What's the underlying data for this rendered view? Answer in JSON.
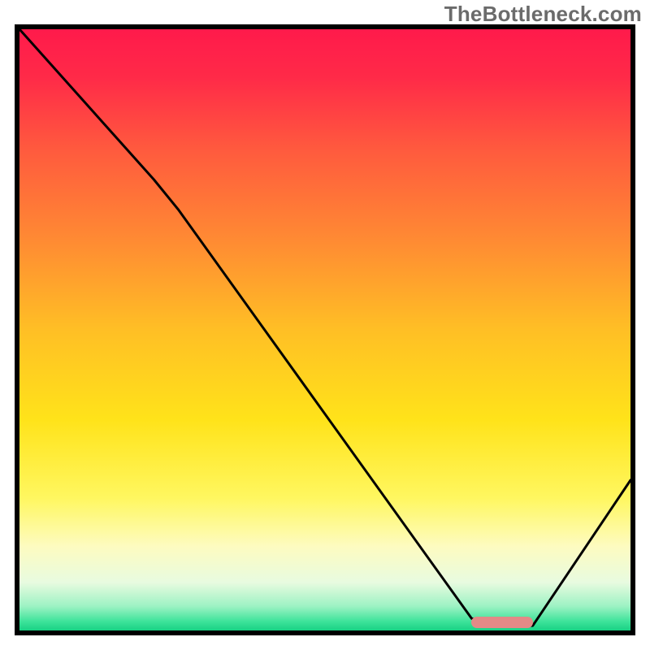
{
  "watermark": "TheBottleneck.com",
  "chart_data": {
    "type": "line",
    "title": "",
    "xlabel": "",
    "ylabel": "",
    "xlim": [
      0,
      100
    ],
    "ylim": [
      0,
      100
    ],
    "grid": false,
    "legend": false,
    "gradient_stops": [
      {
        "offset": 0.0,
        "color": "#ff1a4b"
      },
      {
        "offset": 0.08,
        "color": "#ff2a48"
      },
      {
        "offset": 0.2,
        "color": "#ff5a3e"
      },
      {
        "offset": 0.35,
        "color": "#ff8a33"
      },
      {
        "offset": 0.5,
        "color": "#ffbf25"
      },
      {
        "offset": 0.65,
        "color": "#ffe31a"
      },
      {
        "offset": 0.78,
        "color": "#fff760"
      },
      {
        "offset": 0.86,
        "color": "#fdfbc0"
      },
      {
        "offset": 0.92,
        "color": "#e8fbe0"
      },
      {
        "offset": 0.96,
        "color": "#9cf2c3"
      },
      {
        "offset": 0.985,
        "color": "#3de39a"
      },
      {
        "offset": 1.0,
        "color": "#18d184"
      }
    ],
    "series": [
      {
        "name": "bottleneck-curve",
        "stroke": "#000000",
        "stroke_width": 3,
        "points": [
          {
            "x": 0.0,
            "y": 100.0
          },
          {
            "x": 22.0,
            "y": 75.0
          },
          {
            "x": 26.0,
            "y": 70.0
          },
          {
            "x": 74.0,
            "y": 2.0
          },
          {
            "x": 78.0,
            "y": 0.8
          },
          {
            "x": 84.0,
            "y": 0.8
          },
          {
            "x": 100.0,
            "y": 25.0
          }
        ]
      }
    ],
    "marker": {
      "name": "selected-range",
      "color": "#e38a87",
      "x_start": 74.0,
      "x_end": 84.0,
      "y": 1.4,
      "height_pct": 1.9
    }
  }
}
